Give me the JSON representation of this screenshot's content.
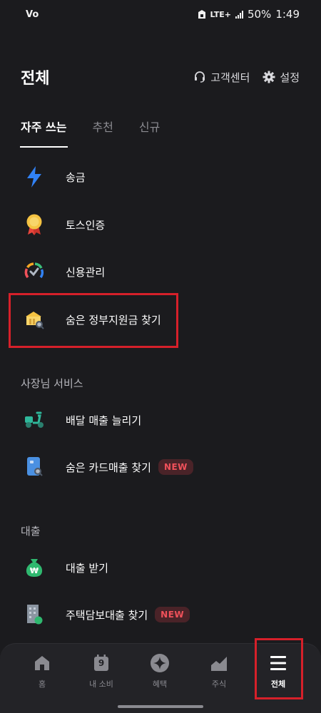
{
  "status_bar": {
    "carrier_icon": "Vo",
    "network": "LTE+",
    "battery": "50%",
    "time": "1:49"
  },
  "header": {
    "title": "전체",
    "customer_center": "고객센터",
    "settings": "설정"
  },
  "tabs": [
    {
      "label": "자주 쓰는",
      "active": true
    },
    {
      "label": "추천",
      "active": false
    },
    {
      "label": "신규",
      "active": false
    }
  ],
  "frequent": [
    {
      "label": "송금",
      "icon": "lightning-icon"
    },
    {
      "label": "토스인증",
      "icon": "medal-icon"
    },
    {
      "label": "신용관리",
      "icon": "credit-gauge-icon"
    },
    {
      "label": "숨은 정부지원금 찾기",
      "icon": "government-building-icon"
    }
  ],
  "business": {
    "title": "사장님 서비스",
    "items": [
      {
        "label": "배달 매출 늘리기",
        "icon": "scooter-icon"
      },
      {
        "label": "숨은 카드매출 찾기",
        "icon": "card-search-icon",
        "badge": "NEW"
      }
    ]
  },
  "loan": {
    "title": "대출",
    "items": [
      {
        "label": "대출 받기",
        "icon": "money-bag-icon"
      },
      {
        "label": "주택담보대출 찾기",
        "icon": "building-search-icon",
        "badge": "NEW"
      }
    ]
  },
  "bottom_nav": [
    {
      "label": "홈",
      "icon": "home-icon"
    },
    {
      "label": "내 소비",
      "icon": "calendar-icon",
      "icon_text": "9"
    },
    {
      "label": "혜택",
      "icon": "sparkle-icon"
    },
    {
      "label": "주식",
      "icon": "chart-icon"
    },
    {
      "label": "전체",
      "icon": "menu-icon",
      "active": true
    }
  ],
  "colors": {
    "background": "#1b1b1e",
    "accent_blue": "#3182f6",
    "badge_red": "#f0515a",
    "highlight_red": "#d6202a"
  }
}
